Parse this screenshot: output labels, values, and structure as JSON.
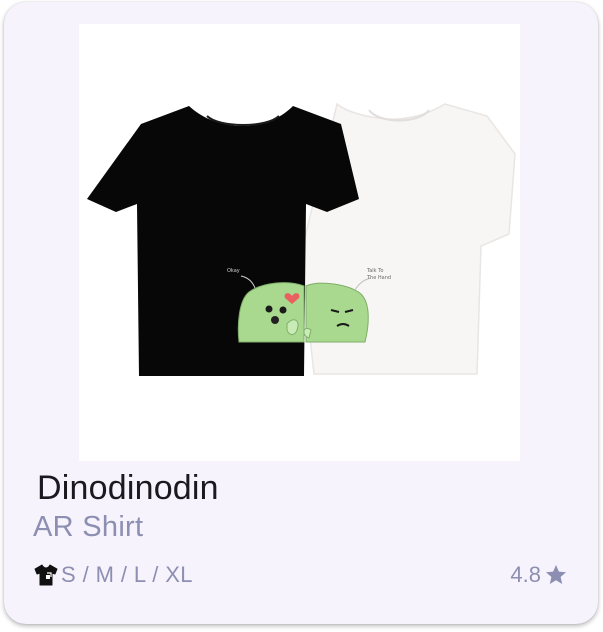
{
  "product": {
    "name": "Dinodinodin",
    "category": "AR Shirt",
    "sizes": "S / M / L / XL",
    "rating": "4.8",
    "image": {
      "speech_left": "Okay",
      "speech_right_line1": "Talk To",
      "speech_right_line2": "The Hand"
    }
  },
  "icons": {
    "sizes": "tshirt-icon",
    "rating": "star-icon"
  },
  "colors": {
    "card_background": "#f6f3fd",
    "muted_text": "#8d8fb2",
    "title_text": "#1a1a1e",
    "dino_green": "#a9d98f"
  }
}
